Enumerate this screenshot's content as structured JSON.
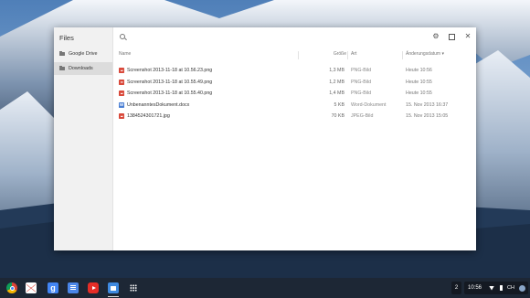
{
  "window": {
    "app_title": "Files"
  },
  "sidebar": {
    "items": [
      {
        "label": "Google Drive",
        "icon": "drive-folder-icon",
        "active": false
      },
      {
        "label": "Downloads",
        "icon": "downloads-folder-icon",
        "active": true
      }
    ]
  },
  "toolbar": {
    "settings_glyph": "⚙",
    "close_glyph": "✕"
  },
  "columns": {
    "name": "Name",
    "size": "Größe",
    "type": "Art",
    "date": "Änderungsdatum",
    "sort_indicator": "▾"
  },
  "files": [
    {
      "name": "Screenshot 2013-11-18 at 10.56.23.png",
      "size": "1,3 MB",
      "type": "PNG-Bild",
      "date": "Heute 10:56",
      "icon": "image-file-icon"
    },
    {
      "name": "Screenshot 2013-11-18 at 10.55.49.png",
      "size": "1,2 MB",
      "type": "PNG-Bild",
      "date": "Heute 10:55",
      "icon": "image-file-icon"
    },
    {
      "name": "Screenshot 2013-11-18 at 10.55.40.png",
      "size": "1,4 MB",
      "type": "PNG-Bild",
      "date": "Heute 10:55",
      "icon": "image-file-icon"
    },
    {
      "name": "UnbenanntesDokument.docx",
      "size": "5 KB",
      "type": "Word-Dokument",
      "date": "15. Nov 2013 16:37",
      "icon": "word-file-icon"
    },
    {
      "name": "1384524301721.jpg",
      "size": "70 KB",
      "type": "JPEG-Bild",
      "date": "15. Nov 2013 15:05",
      "icon": "image-file-icon"
    }
  ],
  "shelf": {
    "apps": [
      "chrome-icon",
      "gmail-icon",
      "google-search-icon",
      "docs-icon",
      "youtube-icon",
      "files-icon",
      "app-launcher-icon"
    ],
    "google_letter": "g",
    "notification_count": "2",
    "clock": "10:56",
    "input_method": "CH"
  },
  "colors": {
    "window_bg": "#ffffff",
    "sidebar_bg": "#f1f1f1",
    "selected_sidebar": "#dcdcdc",
    "image_icon": "#d9493b",
    "doc_icon": "#4a7fd4"
  }
}
